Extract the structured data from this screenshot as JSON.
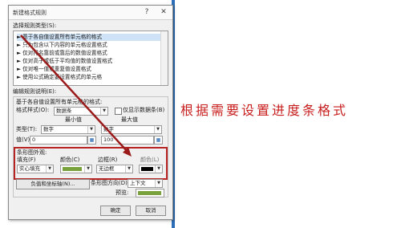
{
  "annotation": {
    "text": "根据需要设置进度条格式",
    "color": "#c81d1d"
  },
  "dialog": {
    "title": "新建格式规则",
    "help_icon": "?",
    "close_icon": "✕",
    "rule_type_label": "选择规则类型(S):",
    "rule_types": [
      "► 基于各自值设置所有单元格的格式",
      "► 只为包含以下内容的单元格设置格式",
      "► 仅对排名靠前或靠后的数值设置格式",
      "► 仅对高于或低于平均值的数值设置格式",
      "► 仅对唯一值或重复值设置格式",
      "► 使用公式确定要设置格式的单元格"
    ],
    "edit_label": "编辑规则说明(E):",
    "edit_section_title": "基于各自值设置所有单元格的格式:",
    "format_style_label": "格式样式(O):",
    "format_style_value": "数据条",
    "show_bar_only_label": "仅显示数据条(B)",
    "min_label": "最小值",
    "max_label": "最大值",
    "type_label": "类型(T):",
    "type_min_value": "数字",
    "type_max_value": "数字",
    "value_label": "值(V):",
    "value_min": "0",
    "value_max": "100",
    "bar_appearance_label": "条形图外观:",
    "fill_label": "填充(F)",
    "fill_value": "实心填充",
    "fill_color_label": "颜色(C)",
    "border_label": "边框(R)",
    "border_value": "无边框",
    "border_color_label": "颜色(L)",
    "neg_axis_button": "负值和坐标轴(N)...",
    "bar_direction_label": "条形图方向(D):",
    "bar_direction_value": "上下文",
    "preview_label": "预览:",
    "ok_button": "确定",
    "cancel_button": "取消",
    "colors": {
      "fill": "#79a23c",
      "border_color": "#000000"
    }
  }
}
